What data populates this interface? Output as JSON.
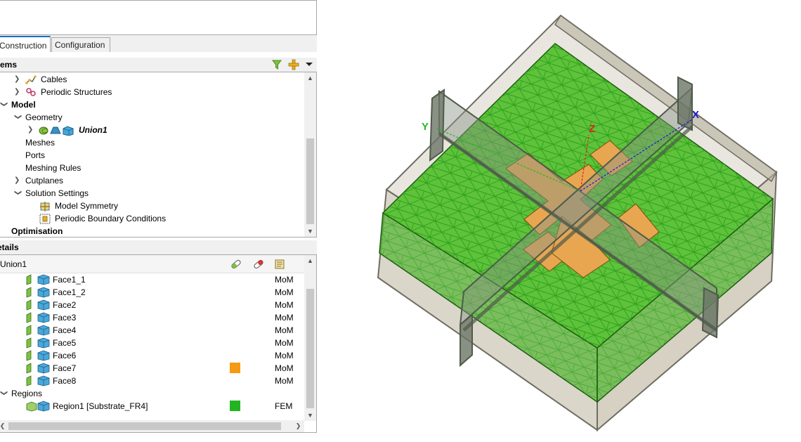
{
  "tabs": [
    {
      "label": "Construction",
      "active": true
    },
    {
      "label": "Configuration",
      "active": false
    }
  ],
  "items_panel": {
    "title": "Items",
    "visible_title": "tems"
  },
  "tree": {
    "rows": [
      {
        "label": "Cables",
        "icon": "cables-icon",
        "chevron": "right"
      },
      {
        "label": "Periodic Structures",
        "icon": "periodic-structures-icon",
        "chevron": "right"
      },
      {
        "label": "Model",
        "bold": true,
        "chevron": "down"
      },
      {
        "label": "Geometry",
        "chevron": "down"
      },
      {
        "label": "Union1",
        "italic_bold": true,
        "icon": "union-geometry-icon",
        "chevron": "right"
      },
      {
        "label": "Meshes"
      },
      {
        "label": "Ports"
      },
      {
        "label": "Meshing Rules"
      },
      {
        "label": "Cutplanes",
        "chevron": "right"
      },
      {
        "label": "Solution Settings",
        "chevron": "down"
      },
      {
        "label": "Model Symmetry",
        "icon": "model-symmetry-icon"
      },
      {
        "label": "Periodic Boundary Conditions",
        "icon": "periodic-boundary-icon"
      },
      {
        "label": "Optimisation",
        "bold": true
      }
    ]
  },
  "details_panel": {
    "title": "Details",
    "visible_title": "etails",
    "root": "Union1",
    "faces": [
      {
        "label": "Face1_1",
        "solver": "MoM",
        "color": ""
      },
      {
        "label": "Face1_2",
        "solver": "MoM",
        "color": ""
      },
      {
        "label": "Face2",
        "solver": "MoM",
        "color": ""
      },
      {
        "label": "Face3",
        "solver": "MoM",
        "color": ""
      },
      {
        "label": "Face4",
        "solver": "MoM",
        "color": ""
      },
      {
        "label": "Face5",
        "solver": "MoM",
        "color": ""
      },
      {
        "label": "Face6",
        "solver": "MoM",
        "color": ""
      },
      {
        "label": "Face7",
        "solver": "MoM",
        "color": "#f59a12"
      },
      {
        "label": "Face8",
        "solver": "MoM",
        "color": ""
      }
    ],
    "regions_label": "Regions",
    "regions": [
      {
        "label": "Region1 [Substrate_FR4]",
        "solver": "FEM",
        "color": "#22b522"
      }
    ]
  },
  "viewport": {
    "axes": {
      "x": "X",
      "y": "Y",
      "z": "Z"
    },
    "colors": {
      "mesh_face": "#5ec23a",
      "patch": "#e8a650",
      "box": "#c9c3b2",
      "axis_x": "#1a1ad6",
      "axis_y": "#22bb22",
      "axis_z": "#e02020"
    }
  }
}
